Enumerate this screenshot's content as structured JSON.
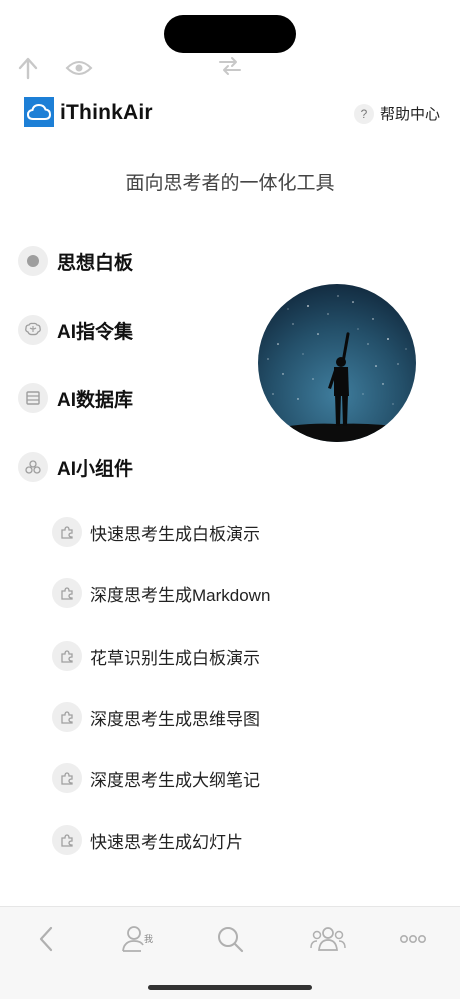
{
  "header": {
    "brand": "iThinkAir",
    "help_label": "帮助中心",
    "help_icon_glyph": "?"
  },
  "tagline": "面向思考者的一体化工具",
  "menu": [
    {
      "label": "思想白板",
      "icon": "dot-icon"
    },
    {
      "label": "AI指令集",
      "icon": "brain-icon"
    },
    {
      "label": "AI数据库",
      "icon": "database-icon"
    },
    {
      "label": "AI小组件",
      "icon": "widgets-icon"
    }
  ],
  "widgets": [
    {
      "label": "快速思考生成白板演示",
      "icon": "puzzle-icon"
    },
    {
      "label": "深度思考生成Markdown",
      "icon": "puzzle-icon"
    },
    {
      "label": "花草识别生成白板演示",
      "icon": "puzzle-icon"
    },
    {
      "label": "深度思考生成思维导图",
      "icon": "puzzle-icon"
    },
    {
      "label": "深度思考生成大纲笔记",
      "icon": "puzzle-icon"
    },
    {
      "label": "快速思考生成幻灯片",
      "icon": "puzzle-icon"
    }
  ],
  "bottom_nav": {
    "back_icon": "chevron-left-icon",
    "me_icon": "person-icon",
    "me_badge": "我",
    "search_icon": "search-icon",
    "group_icon": "group-icon",
    "more_icon": "more-icon"
  },
  "colors": {
    "brand_blue": "#1d7fd6",
    "icon_circle_bg": "#eeeeee",
    "bottom_bar_bg": "#f7f7f7"
  }
}
